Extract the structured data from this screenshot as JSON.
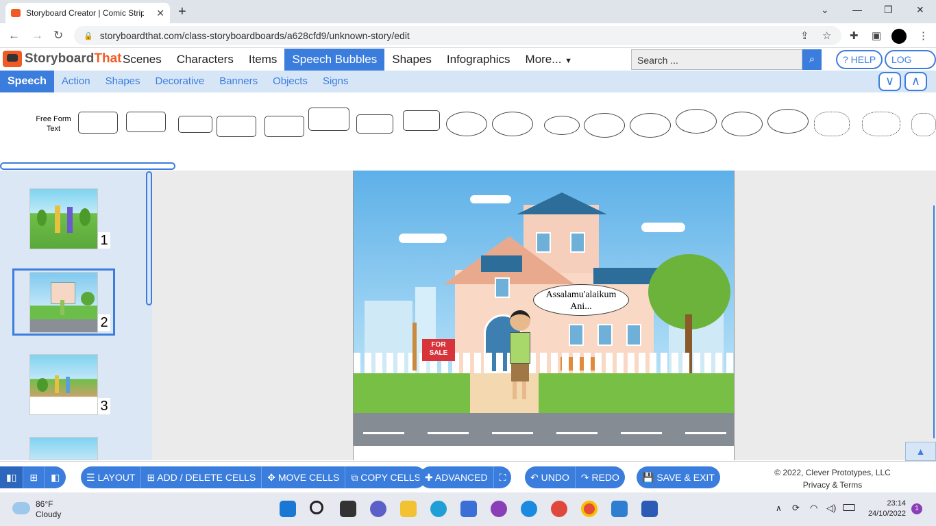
{
  "browser": {
    "tab_title": "Storyboard Creator | Comic Strip",
    "url": "storyboardthat.com/class-storyboardboards/a628cfd9/unknown-story/edit"
  },
  "app": {
    "logo_part1": "Storyboard",
    "logo_part2": "That",
    "nav": [
      "Scenes",
      "Characters",
      "Items",
      "Speech Bubbles",
      "Shapes",
      "Infographics",
      "More..."
    ],
    "nav_active": "Speech Bubbles",
    "search_placeholder": "Search ...",
    "help_label": "? HELP",
    "logout_label": "LOG OUT"
  },
  "subnav": {
    "items": [
      "Speech",
      "Action",
      "Shapes",
      "Decorative",
      "Banners",
      "Objects",
      "Signs"
    ],
    "active": "Speech"
  },
  "palette": {
    "free_form_label": "Free Form Text"
  },
  "cells": [
    {
      "number": "1"
    },
    {
      "number": "2"
    },
    {
      "number": "3"
    }
  ],
  "scene": {
    "speech_text": "Assalamu'alaikum Ani...",
    "sign_text": "FOR SALE"
  },
  "toolbar": {
    "layout": "LAYOUT",
    "add_delete": "ADD / DELETE CELLS",
    "move": "MOVE CELLS",
    "copy": "COPY CELLS",
    "advanced": "ADVANCED",
    "undo": "UNDO",
    "redo": "REDO",
    "save_exit": "SAVE & EXIT",
    "copyright": "© 2022, Clever Prototypes, LLC",
    "privacy": "Privacy & Terms"
  },
  "taskbar": {
    "temperature": "86°F",
    "weather": "Cloudy",
    "time": "23:14",
    "date": "24/10/2022",
    "notifications": "1"
  },
  "colors": {
    "accent": "#3b7ddd",
    "brand_orange": "#f15a24"
  }
}
